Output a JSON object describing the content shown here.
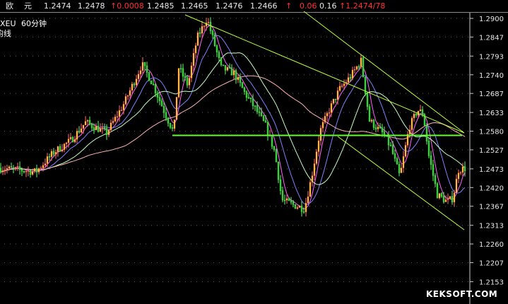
{
  "quote_bar": {
    "name": "欧",
    "name2": "元",
    "price": "1.2474",
    "bid": "1.2478",
    "change_up": "↑0.0008",
    "high": "1.2485",
    "low": "1.2465",
    "value4": "1.2476",
    "value5": "1.2466",
    "arrow": "↑",
    "pct": "0.06",
    "amp": "0.16",
    "last_up": "↑1.2474/78"
  },
  "chart_data": {
    "type": "candlestick",
    "symbol_label": "XEU",
    "period_label": "60分钟",
    "indicator_label": "均线",
    "y_ticks": [
      "1.2900",
      "1.2847",
      "1.2793",
      "1.2740",
      "1.2687",
      "1.2633",
      "1.2580",
      "1.2527",
      "1.2473",
      "1.2420",
      "1.2367",
      "1.2313",
      "1.2260",
      "1.2207",
      "1.2153"
    ],
    "y_range": [
      1.2127,
      1.2927
    ],
    "price_path": [
      [
        0,
        1.2475
      ],
      [
        50,
        1.2465
      ],
      [
        75,
        1.252
      ],
      [
        100,
        1.2555
      ],
      [
        120,
        1.2605
      ],
      [
        150,
        1.2575
      ],
      [
        175,
        1.266
      ],
      [
        200,
        1.277
      ],
      [
        215,
        1.2715
      ],
      [
        235,
        1.262
      ],
      [
        245,
        1.2575
      ],
      [
        252,
        1.276
      ],
      [
        265,
        1.271
      ],
      [
        278,
        1.2845
      ],
      [
        292,
        1.29
      ],
      [
        300,
        1.2845
      ],
      [
        312,
        1.276
      ],
      [
        330,
        1.2745
      ],
      [
        345,
        1.269
      ],
      [
        360,
        1.2645
      ],
      [
        375,
        1.2595
      ],
      [
        388,
        1.252
      ],
      [
        398,
        1.2385
      ],
      [
        415,
        1.237
      ],
      [
        430,
        1.236
      ],
      [
        440,
        1.245
      ],
      [
        452,
        1.258
      ],
      [
        465,
        1.264
      ],
      [
        480,
        1.27
      ],
      [
        495,
        1.2735
      ],
      [
        510,
        1.278
      ],
      [
        522,
        1.261
      ],
      [
        540,
        1.2575
      ],
      [
        552,
        1.2535
      ],
      [
        565,
        1.245
      ],
      [
        578,
        1.259
      ],
      [
        590,
        1.264
      ],
      [
        598,
        1.263
      ],
      [
        606,
        1.251
      ],
      [
        618,
        1.24
      ],
      [
        632,
        1.238
      ],
      [
        640,
        1.239
      ],
      [
        648,
        1.247
      ],
      [
        657,
        1.2475
      ]
    ],
    "support_level": 1.2568,
    "trend_lines": [
      {
        "from": [
          262,
          1.291
        ],
        "to": [
          657,
          1.2575
        ]
      },
      {
        "from": [
          430,
          1.292
        ],
        "to": [
          657,
          1.2575
        ]
      },
      {
        "from": [
          478,
          1.2565
        ],
        "to": [
          657,
          1.23
        ]
      }
    ],
    "ma_lines": [
      {
        "color": "#ff60ff",
        "period": 5
      },
      {
        "color": "#8080ff",
        "period": 12
      },
      {
        "color": "#c0ffc0",
        "period": 24
      },
      {
        "color": "#ffb0b0",
        "period": 60
      }
    ]
  },
  "watermark": "KEKSOFT.COM"
}
